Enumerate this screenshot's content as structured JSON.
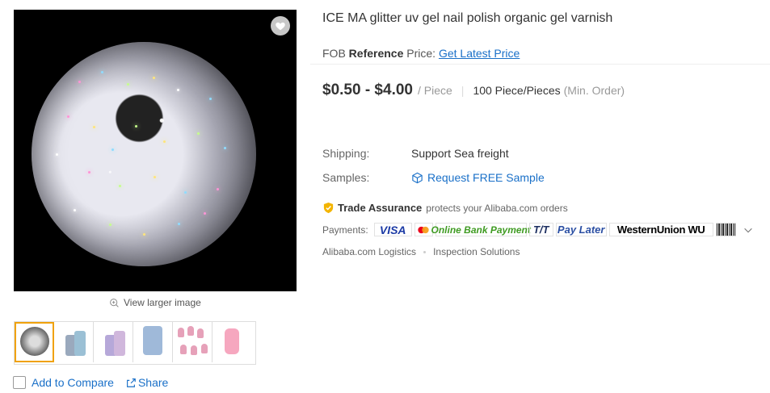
{
  "product": {
    "title": "ICE MA glitter uv gel nail polish organic gel varnish"
  },
  "pricing": {
    "fob_prefix": "FOB",
    "fob_reference": "Reference",
    "fob_suffix": "Price:",
    "latest_price_link": "Get Latest Price",
    "price_range": "$0.50 - $4.00",
    "unit": "/ Piece",
    "divider": "|",
    "min_order_quantity": "100 Piece/Pieces",
    "min_order_label": "(Min. Order)"
  },
  "shipping": {
    "label": "Shipping:",
    "value": "Support Sea freight"
  },
  "samples": {
    "label": "Samples:",
    "link": "Request FREE Sample"
  },
  "trade_assurance": {
    "title": "Trade Assurance",
    "text": "protects your Alibaba.com orders"
  },
  "payments": {
    "label": "Payments:",
    "methods": [
      "VISA",
      "Mastercard",
      "Online Bank Payment",
      "T/T",
      "Pay Later",
      "WesternUnion WU",
      "Boleto"
    ]
  },
  "services": [
    "Alibaba.com Logistics",
    "Inspection Solutions"
  ],
  "gallery": {
    "view_larger": "View larger image",
    "thumbnail_count": 6,
    "selected_index": 0
  },
  "actions": {
    "add_to_compare": "Add to Compare",
    "share": "Share"
  },
  "colors": {
    "link_blue": "#1a70c8",
    "selected_thumb": "#f0a20d",
    "bank_green": "#3f9b22"
  },
  "icons": [
    "heart-icon",
    "magnify-plus-icon",
    "sample-box-icon",
    "shield-icon",
    "share-icon",
    "chevron-down-icon"
  ]
}
